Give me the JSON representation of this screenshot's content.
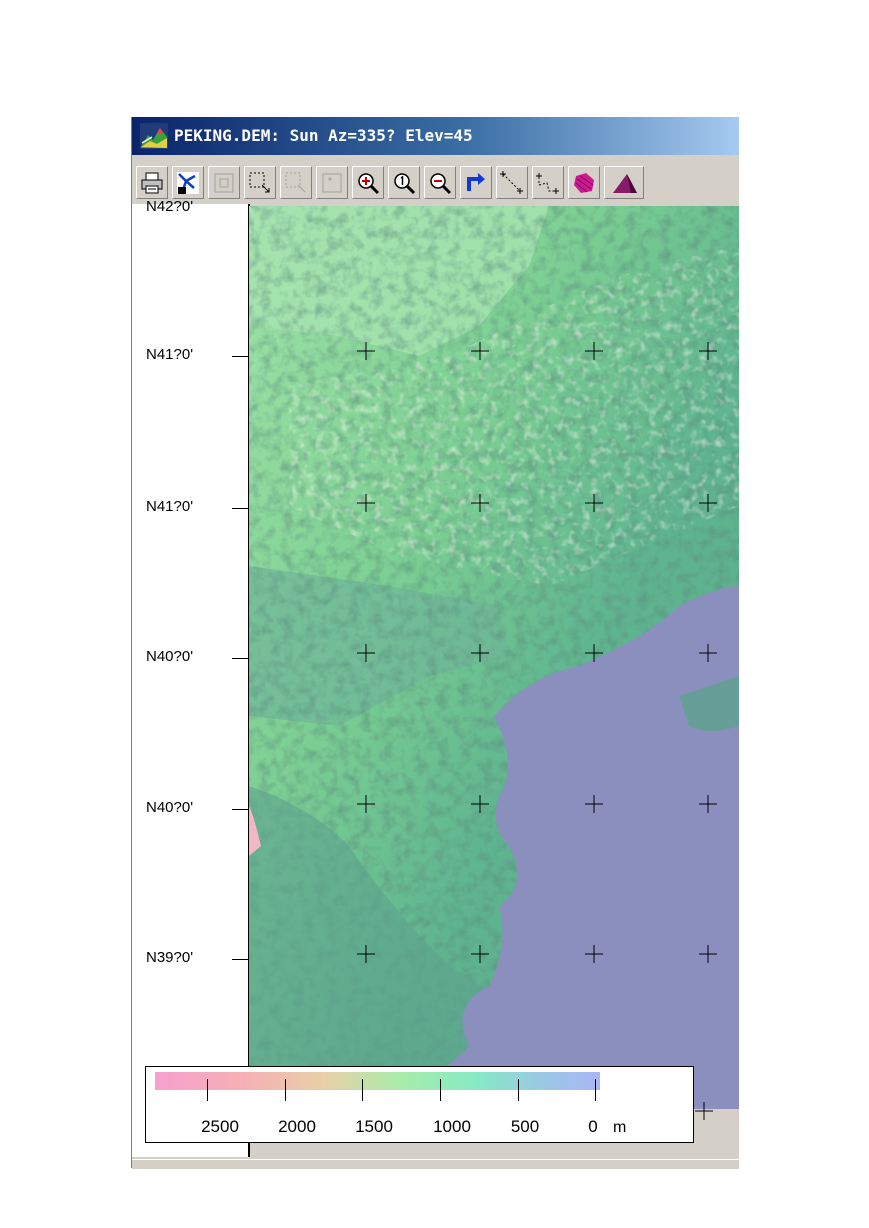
{
  "window": {
    "title": "PEKING.DEM: Sun Az=335? Elev=45",
    "app_icon": "dem-map-icon"
  },
  "toolbar": {
    "buttons": [
      {
        "name": "print-button",
        "icon": "printer-icon"
      },
      {
        "name": "drainage-button",
        "icon": "drainage-network-icon"
      },
      {
        "name": "fit-view-button",
        "icon": "fit-view-icon",
        "disabled": true
      },
      {
        "name": "select-area-button",
        "icon": "select-area-icon"
      },
      {
        "name": "select-area-alt-button",
        "icon": "select-area-alt-icon",
        "disabled": true
      },
      {
        "name": "full-extent-button",
        "icon": "full-extent-icon",
        "disabled": true
      },
      {
        "name": "zoom-in-button",
        "icon": "zoom-in-icon"
      },
      {
        "name": "zoom-1x-button",
        "icon": "zoom-1x-icon"
      },
      {
        "name": "zoom-out-button",
        "icon": "zoom-out-icon"
      },
      {
        "name": "redraw-button",
        "icon": "redraw-arrow-icon"
      },
      {
        "name": "measure-distance-button",
        "icon": "measure-line-icon"
      },
      {
        "name": "measure-path-button",
        "icon": "measure-path-icon"
      },
      {
        "name": "area-button",
        "icon": "area-polygon-icon"
      },
      {
        "name": "profile-button",
        "icon": "profile-3d-icon"
      }
    ]
  },
  "latitude_labels": [
    "N42?0'",
    "N41?0'",
    "N41?0'",
    "N40?0'",
    "N40?0'",
    "N39?0'"
  ],
  "legend": {
    "values": [
      "2500",
      "2000",
      "1500",
      "1000",
      "500",
      "0"
    ],
    "unit": "m"
  },
  "colors": {
    "low_elevation": "#8a8fbe",
    "mid_elevation": "#5fb58f",
    "high_elevation": "#f1b7c4",
    "titlebar_start": "#0a246a",
    "titlebar_end": "#a6caf0"
  }
}
